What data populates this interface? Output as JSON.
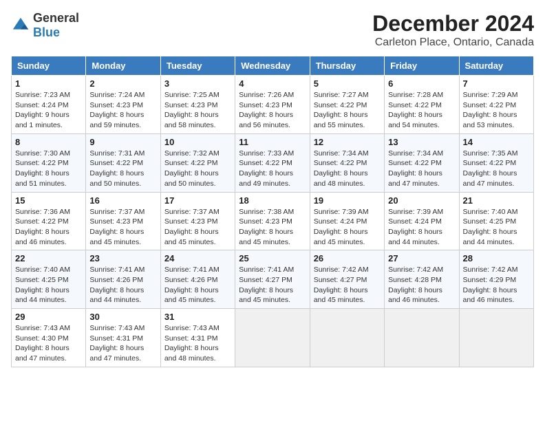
{
  "logo": {
    "general": "General",
    "blue": "Blue"
  },
  "title": "December 2024",
  "subtitle": "Carleton Place, Ontario, Canada",
  "days_of_week": [
    "Sunday",
    "Monday",
    "Tuesday",
    "Wednesday",
    "Thursday",
    "Friday",
    "Saturday"
  ],
  "weeks": [
    [
      {
        "day": "1",
        "sunrise": "7:23 AM",
        "sunset": "4:24 PM",
        "daylight_hours": "9",
        "daylight_minutes": "1"
      },
      {
        "day": "2",
        "sunrise": "7:24 AM",
        "sunset": "4:23 PM",
        "daylight_hours": "8",
        "daylight_minutes": "59"
      },
      {
        "day": "3",
        "sunrise": "7:25 AM",
        "sunset": "4:23 PM",
        "daylight_hours": "8",
        "daylight_minutes": "58"
      },
      {
        "day": "4",
        "sunrise": "7:26 AM",
        "sunset": "4:23 PM",
        "daylight_hours": "8",
        "daylight_minutes": "56"
      },
      {
        "day": "5",
        "sunrise": "7:27 AM",
        "sunset": "4:22 PM",
        "daylight_hours": "8",
        "daylight_minutes": "55"
      },
      {
        "day": "6",
        "sunrise": "7:28 AM",
        "sunset": "4:22 PM",
        "daylight_hours": "8",
        "daylight_minutes": "54"
      },
      {
        "day": "7",
        "sunrise": "7:29 AM",
        "sunset": "4:22 PM",
        "daylight_hours": "8",
        "daylight_minutes": "53"
      }
    ],
    [
      {
        "day": "8",
        "sunrise": "7:30 AM",
        "sunset": "4:22 PM",
        "daylight_hours": "8",
        "daylight_minutes": "51"
      },
      {
        "day": "9",
        "sunrise": "7:31 AM",
        "sunset": "4:22 PM",
        "daylight_hours": "8",
        "daylight_minutes": "50"
      },
      {
        "day": "10",
        "sunrise": "7:32 AM",
        "sunset": "4:22 PM",
        "daylight_hours": "8",
        "daylight_minutes": "50"
      },
      {
        "day": "11",
        "sunrise": "7:33 AM",
        "sunset": "4:22 PM",
        "daylight_hours": "8",
        "daylight_minutes": "49"
      },
      {
        "day": "12",
        "sunrise": "7:34 AM",
        "sunset": "4:22 PM",
        "daylight_hours": "8",
        "daylight_minutes": "48"
      },
      {
        "day": "13",
        "sunrise": "7:34 AM",
        "sunset": "4:22 PM",
        "daylight_hours": "8",
        "daylight_minutes": "47"
      },
      {
        "day": "14",
        "sunrise": "7:35 AM",
        "sunset": "4:22 PM",
        "daylight_hours": "8",
        "daylight_minutes": "47"
      }
    ],
    [
      {
        "day": "15",
        "sunrise": "7:36 AM",
        "sunset": "4:22 PM",
        "daylight_hours": "8",
        "daylight_minutes": "46"
      },
      {
        "day": "16",
        "sunrise": "7:37 AM",
        "sunset": "4:23 PM",
        "daylight_hours": "8",
        "daylight_minutes": "45"
      },
      {
        "day": "17",
        "sunrise": "7:37 AM",
        "sunset": "4:23 PM",
        "daylight_hours": "8",
        "daylight_minutes": "45"
      },
      {
        "day": "18",
        "sunrise": "7:38 AM",
        "sunset": "4:23 PM",
        "daylight_hours": "8",
        "daylight_minutes": "45"
      },
      {
        "day": "19",
        "sunrise": "7:39 AM",
        "sunset": "4:24 PM",
        "daylight_hours": "8",
        "daylight_minutes": "45"
      },
      {
        "day": "20",
        "sunrise": "7:39 AM",
        "sunset": "4:24 PM",
        "daylight_hours": "8",
        "daylight_minutes": "44"
      },
      {
        "day": "21",
        "sunrise": "7:40 AM",
        "sunset": "4:25 PM",
        "daylight_hours": "8",
        "daylight_minutes": "44"
      }
    ],
    [
      {
        "day": "22",
        "sunrise": "7:40 AM",
        "sunset": "4:25 PM",
        "daylight_hours": "8",
        "daylight_minutes": "44"
      },
      {
        "day": "23",
        "sunrise": "7:41 AM",
        "sunset": "4:26 PM",
        "daylight_hours": "8",
        "daylight_minutes": "44"
      },
      {
        "day": "24",
        "sunrise": "7:41 AM",
        "sunset": "4:26 PM",
        "daylight_hours": "8",
        "daylight_minutes": "45"
      },
      {
        "day": "25",
        "sunrise": "7:41 AM",
        "sunset": "4:27 PM",
        "daylight_hours": "8",
        "daylight_minutes": "45"
      },
      {
        "day": "26",
        "sunrise": "7:42 AM",
        "sunset": "4:27 PM",
        "daylight_hours": "8",
        "daylight_minutes": "45"
      },
      {
        "day": "27",
        "sunrise": "7:42 AM",
        "sunset": "4:28 PM",
        "daylight_hours": "8",
        "daylight_minutes": "46"
      },
      {
        "day": "28",
        "sunrise": "7:42 AM",
        "sunset": "4:29 PM",
        "daylight_hours": "8",
        "daylight_minutes": "46"
      }
    ],
    [
      {
        "day": "29",
        "sunrise": "7:43 AM",
        "sunset": "4:30 PM",
        "daylight_hours": "8",
        "daylight_minutes": "47"
      },
      {
        "day": "30",
        "sunrise": "7:43 AM",
        "sunset": "4:31 PM",
        "daylight_hours": "8",
        "daylight_minutes": "47"
      },
      {
        "day": "31",
        "sunrise": "7:43 AM",
        "sunset": "4:31 PM",
        "daylight_hours": "8",
        "daylight_minutes": "48"
      },
      null,
      null,
      null,
      null
    ]
  ],
  "labels": {
    "sunrise": "Sunrise:",
    "sunset": "Sunset:",
    "daylight": "Daylight:"
  }
}
